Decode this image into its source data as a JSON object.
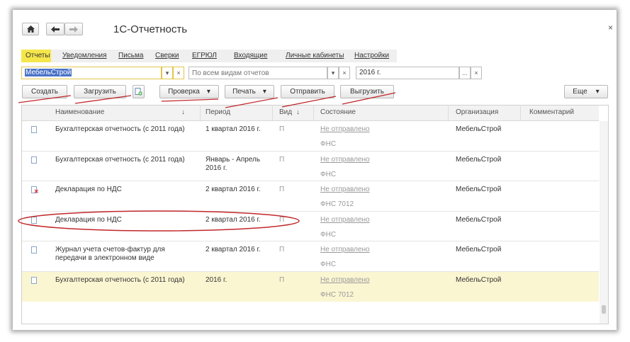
{
  "window": {
    "title": "1С-Отчетность",
    "close_glyph": "×",
    "nav_home_icon": "home-icon",
    "nav_back_icon": "arrow-left-icon",
    "nav_forward_icon": "arrow-right-icon"
  },
  "tabs": [
    {
      "label": "Отчеты",
      "active": true
    },
    {
      "label": "Уведомления"
    },
    {
      "label": "Письма"
    },
    {
      "label": "Сверки"
    },
    {
      "label": "ЕГРЮЛ"
    },
    {
      "label": "Входящие"
    },
    {
      "label": "Личные кабинеты"
    },
    {
      "label": "Настройки"
    }
  ],
  "filters": {
    "organization": "МебельСтрой",
    "report_kind_placeholder": "По всем видам отчетов",
    "period": "2016 г.",
    "dropdown_glyph": "▾",
    "clear_glyph": "×",
    "more_glyph": "..."
  },
  "toolbar": {
    "create": "Создать",
    "load": "Загрузить",
    "check": "Проверка",
    "print": "Печать",
    "send": "Отправить",
    "export": "Выгрузить",
    "more": "Еще",
    "arrow": "▾"
  },
  "table": {
    "headers": {
      "name": "Наименование",
      "period": "Период",
      "kind": "Вид",
      "state": "Состояние",
      "org": "Организация",
      "comment": "Комментарий",
      "sort_arrow": "↓"
    },
    "rows": [
      {
        "name": "Бухгалтерская отчетность (с 2011 года)",
        "period": "1 квартал 2016 г.",
        "kind": "П",
        "state": "Не отправлено",
        "recipient": "ФНС",
        "org": "МебельСтрой",
        "icon": "document-icon"
      },
      {
        "name": "Бухгалтерская отчетность (с 2011 года)",
        "period": "Январь - Апрель 2016 г.",
        "kind": "П",
        "state": "Не отправлено",
        "recipient": "ФНС",
        "org": "МебельСтрой",
        "icon": "document-icon"
      },
      {
        "name": "Декларация по НДС",
        "period": "2 квартал 2016 г.",
        "kind": "П",
        "state": "Не отправлено",
        "recipient": "ФНС 7012",
        "org": "МебельСтрой",
        "icon": "document-error-icon"
      },
      {
        "name": "Декларация по НДС",
        "period": "2 квартал 2016 г.",
        "kind": "П",
        "state": "Не отправлено",
        "recipient": "ФНС",
        "org": "МебельСтрой",
        "icon": "document-icon"
      },
      {
        "name": "Журнал учета счетов-фактур для передачи в электронном виде",
        "period": "2 квартал 2016 г.",
        "kind": "П",
        "state": "Не отправлено",
        "recipient": "ФНС",
        "org": "МебельСтрой",
        "icon": "document-icon"
      },
      {
        "name": "Бухгалтерская отчетность (с 2011 года)",
        "period": "2016 г.",
        "kind": "П",
        "state": "Не отправлено",
        "recipient": "ФНС 7012",
        "org": "МебельСтрой",
        "icon": "document-icon",
        "selected": true
      }
    ]
  },
  "colors": {
    "active_tab": "#f5e64b",
    "selected_row": "#fbf6d2",
    "annotation_red": "#c0282b",
    "selection_blue": "#4a72c7"
  }
}
